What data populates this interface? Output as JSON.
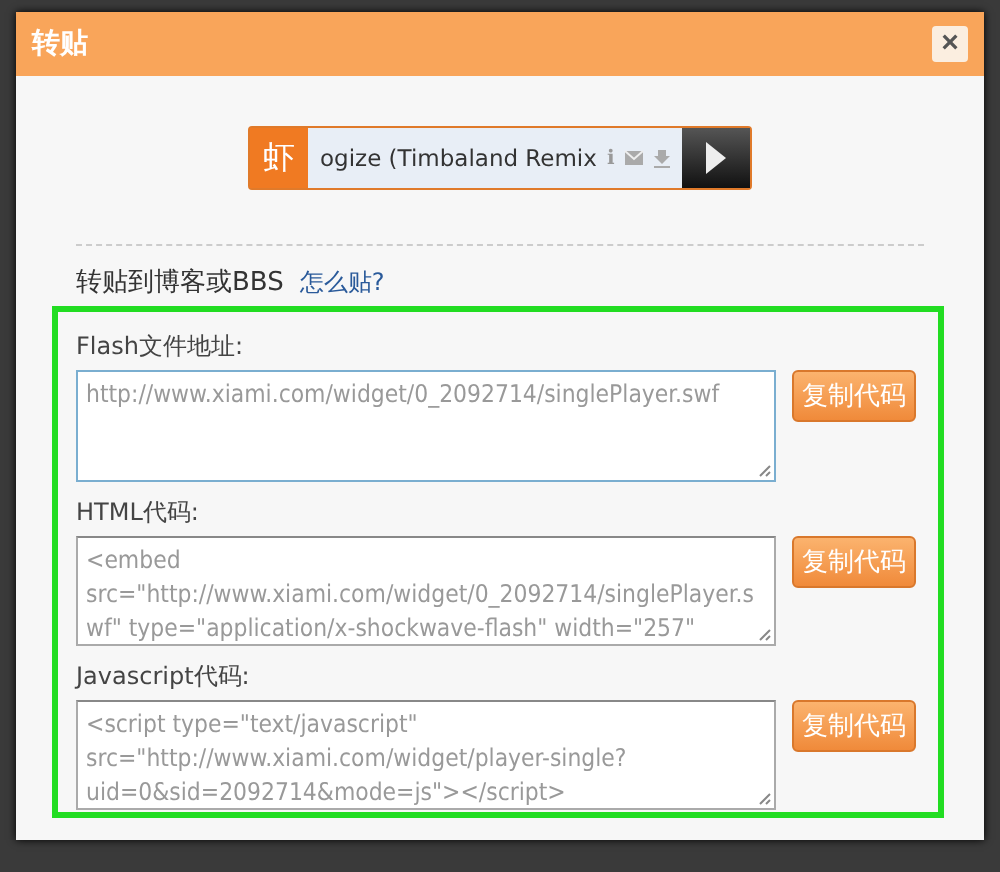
{
  "dialog": {
    "title": "转贴",
    "close": "×"
  },
  "player": {
    "logo": "虾",
    "track": "ogize (Timbaland Remix",
    "info": "i"
  },
  "section": {
    "heading": "转贴到博客或BBS",
    "help_link": "怎么贴?"
  },
  "fields": [
    {
      "label": "Flash文件地址:",
      "value": "http://www.xiami.com/widget/0_2092714/singlePlayer.swf",
      "button": "复制代码",
      "focused": true
    },
    {
      "label": "HTML代码:",
      "value": "<embed src=\"http://www.xiami.com/widget/0_2092714/singlePlayer.swf\" type=\"application/x-shockwave-flash\" width=\"257\"",
      "button": "复制代码",
      "focused": false
    },
    {
      "label": "Javascript代码:",
      "value": "<script type=\"text/javascript\" src=\"http://www.xiami.com/widget/player-single?uid=0&sid=2092714&mode=js\"></script>",
      "button": "复制代码",
      "focused": false
    }
  ]
}
